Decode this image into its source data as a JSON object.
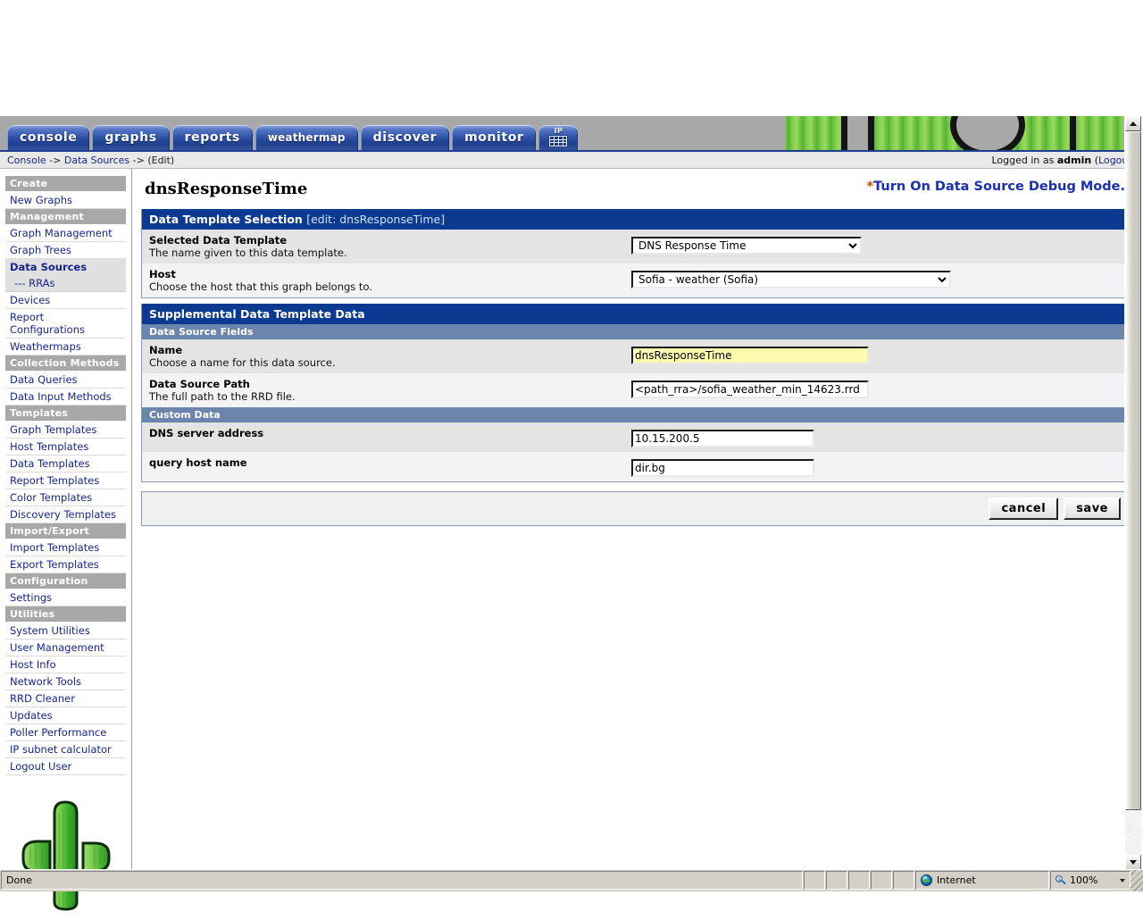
{
  "browser": {
    "status_text": "Done",
    "zone_label": "Internet",
    "zoom_label": "100%"
  },
  "tabs": [
    {
      "label": "console",
      "name": "tab-console"
    },
    {
      "label": "graphs",
      "name": "tab-graphs"
    },
    {
      "label": "reports",
      "name": "tab-reports"
    },
    {
      "label": "weathermap",
      "name": "tab-weathermap"
    },
    {
      "label": "discover",
      "name": "tab-discover"
    },
    {
      "label": "monitor",
      "name": "tab-monitor"
    },
    {
      "label": "IP",
      "name": "tab-ip-calculator"
    }
  ],
  "breadcrumb": {
    "console": "Console",
    "sep1": "->",
    "data_sources": "Data Sources",
    "sep2": "->",
    "current": "(Edit)",
    "logged_in_prefix": "Logged in as",
    "user": "admin",
    "logout_open": "(",
    "logout": "Logout",
    "logout_close": ")"
  },
  "sidebar": {
    "sections": [
      {
        "title": "Create",
        "items": [
          {
            "label": "New Graphs",
            "active": false,
            "sub": false
          }
        ]
      },
      {
        "title": "Management",
        "items": [
          {
            "label": "Graph Management",
            "active": false,
            "sub": false
          },
          {
            "label": "Graph Trees",
            "active": false,
            "sub": false
          },
          {
            "label": "Data Sources",
            "active": true,
            "sub": false
          },
          {
            "label": "--- RRAs",
            "active": false,
            "sub": true
          },
          {
            "label": "Devices",
            "active": false,
            "sub": false
          },
          {
            "label": "Report Configurations",
            "active": false,
            "sub": false
          },
          {
            "label": "Weathermaps",
            "active": false,
            "sub": false
          }
        ]
      },
      {
        "title": "Collection Methods",
        "items": [
          {
            "label": "Data Queries",
            "active": false,
            "sub": false
          },
          {
            "label": "Data Input Methods",
            "active": false,
            "sub": false
          }
        ]
      },
      {
        "title": "Templates",
        "items": [
          {
            "label": "Graph Templates",
            "active": false,
            "sub": false
          },
          {
            "label": "Host Templates",
            "active": false,
            "sub": false
          },
          {
            "label": "Data Templates",
            "active": false,
            "sub": false
          },
          {
            "label": "Report Templates",
            "active": false,
            "sub": false
          },
          {
            "label": "Color Templates",
            "active": false,
            "sub": false
          },
          {
            "label": "Discovery Templates",
            "active": false,
            "sub": false
          }
        ]
      },
      {
        "title": "Import/Export",
        "items": [
          {
            "label": "Import Templates",
            "active": false,
            "sub": false
          },
          {
            "label": "Export Templates",
            "active": false,
            "sub": false
          }
        ]
      },
      {
        "title": "Configuration",
        "items": [
          {
            "label": "Settings",
            "active": false,
            "sub": false
          }
        ]
      },
      {
        "title": "Utilities",
        "items": [
          {
            "label": "System Utilities",
            "active": false,
            "sub": false
          },
          {
            "label": "User Management",
            "active": false,
            "sub": false
          },
          {
            "label": "Host Info",
            "active": false,
            "sub": false
          },
          {
            "label": "Network Tools",
            "active": false,
            "sub": false
          },
          {
            "label": "RRD Cleaner",
            "active": false,
            "sub": false
          },
          {
            "label": "Updates",
            "active": false,
            "sub": false
          },
          {
            "label": "Poller Performance",
            "active": false,
            "sub": false
          },
          {
            "label": "IP subnet calculator",
            "active": false,
            "sub": false
          },
          {
            "label": "Logout User",
            "active": false,
            "sub": false
          }
        ]
      }
    ]
  },
  "main": {
    "page_title": "dnsResponseTime",
    "debug_star": "*",
    "debug_link": "Turn On Data Source Debug Mode.",
    "panel1": {
      "title": "Data Template Selection",
      "subtitle": "[edit: dnsResponseTime]",
      "rows": [
        {
          "label": "Selected Data Template",
          "desc": "The name given to this data template.",
          "value": "DNS Response Time"
        },
        {
          "label": "Host",
          "desc": "Choose the host that this graph belongs to.",
          "value": "Sofia - weather (Sofia)"
        }
      ]
    },
    "panel2": {
      "title": "Supplemental Data Template Data",
      "subhead_fields": "Data Source Fields",
      "subhead_custom": "Custom Data",
      "rows": [
        {
          "label": "Name",
          "desc": "Choose a name for this data source.",
          "value": "dnsResponseTime"
        },
        {
          "label": "Data Source Path",
          "desc": "The full path to the RRD file.",
          "value": "<path_rra>/sofia_weather_min_14623.rrd"
        }
      ],
      "custom_rows": [
        {
          "label": "DNS server address",
          "value": "10.15.200.5"
        },
        {
          "label": "query host name",
          "value": "dir.bg"
        }
      ]
    },
    "actions": {
      "cancel": "cancel",
      "save": "save"
    }
  },
  "colors": {
    "panel_header_blue": "#0b3a90",
    "subhead_blue": "#6c85ad",
    "link_blue": "#17258c",
    "debug_blue": "#1b2fb5",
    "highlight_yellow": "#fdfbb0",
    "nav_section_gray": "#a8a8a8"
  }
}
